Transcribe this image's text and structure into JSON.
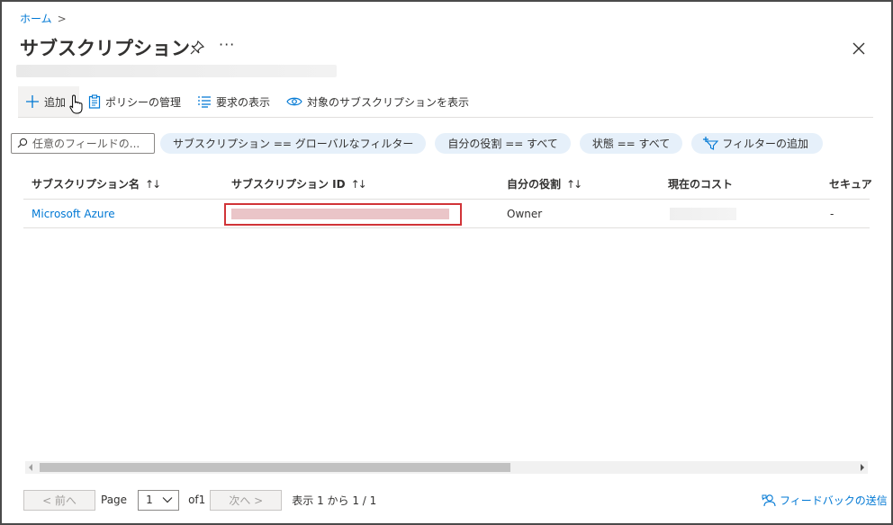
{
  "breadcrumb": {
    "home": "ホーム",
    "separator": ">"
  },
  "title": "サブスクリプション",
  "title_more": "···",
  "toolbar": {
    "add": "追加",
    "policy": "ポリシーの管理",
    "requests": "要求の表示",
    "eligible": "対象のサブスクリプションを表示"
  },
  "filters": {
    "search_placeholder": "任意のフィールドの...",
    "pills": [
      "サブスクリプション == グローバルなフィルター",
      "自分の役割 == すべて",
      "状態 == すべて"
    ],
    "add_filter": "フィルターの追加"
  },
  "table": {
    "columns": [
      "サブスクリプション名",
      "サブスクリプション ID",
      "自分の役割",
      "現在のコスト",
      "セキュア"
    ],
    "sort_glyph": "↑↓",
    "rows": [
      {
        "name": "Microsoft Azure",
        "role": "Owner",
        "secure": "-"
      }
    ]
  },
  "pager": {
    "prev": "< 前へ",
    "page_label": "Page",
    "page_value": "1",
    "of": "of1",
    "next": "次へ >",
    "summary": "表示 1 から 1 / 1"
  },
  "feedback": "フィードバックの送信",
  "colors": {
    "accent": "#0078d4",
    "highlight_border": "#d13438",
    "pill_bg": "#e6f0fa"
  }
}
